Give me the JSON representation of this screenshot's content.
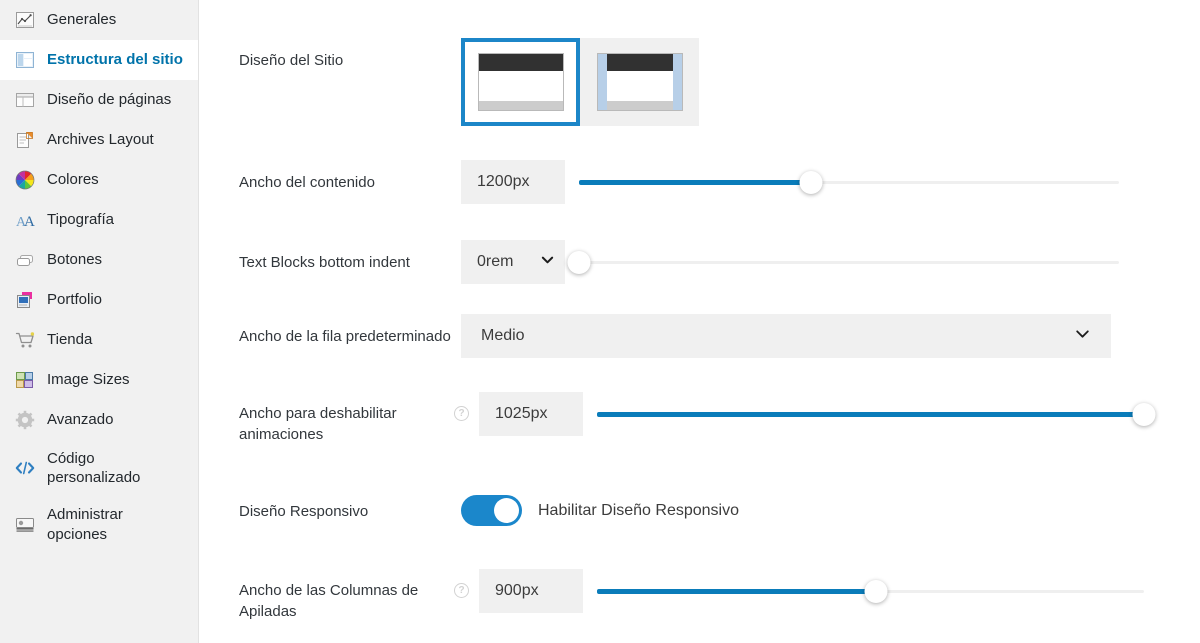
{
  "sidebar": {
    "items": [
      {
        "label": "Generales",
        "icon": "chart-icon",
        "active": false
      },
      {
        "label": "Estructura del sitio",
        "icon": "layout-panel-icon",
        "active": true
      },
      {
        "label": "Diseño de páginas",
        "icon": "page-layout-icon",
        "active": false
      },
      {
        "label": "Archives Layout",
        "icon": "archive-icon",
        "active": false
      },
      {
        "label": "Colores",
        "icon": "color-wheel-icon",
        "active": false
      },
      {
        "label": "Tipografía",
        "icon": "typography-icon",
        "active": false
      },
      {
        "label": "Botones",
        "icon": "buttons-icon",
        "active": false
      },
      {
        "label": "Portfolio",
        "icon": "portfolio-icon",
        "active": false
      },
      {
        "label": "Tienda",
        "icon": "cart-icon",
        "active": false
      },
      {
        "label": "Image Sizes",
        "icon": "image-sizes-icon",
        "active": false
      },
      {
        "label": "Avanzado",
        "icon": "gear-icon",
        "active": false
      },
      {
        "label": "Código\npersonalizado",
        "icon": "code-icon",
        "active": false
      },
      {
        "label": "Administrar\nopciones",
        "icon": "manage-options-icon",
        "active": false
      }
    ]
  },
  "settings": {
    "site_layout": {
      "label": "Diseño del Sitio",
      "options": [
        {
          "name": "full-width-layout",
          "selected": true
        },
        {
          "name": "boxed-layout",
          "selected": false
        }
      ]
    },
    "content_width": {
      "label": "Ancho del contenido",
      "value": "1200px",
      "slider_percent": 43
    },
    "text_blocks_indent": {
      "label": "Text Blocks bottom indent",
      "value": "0rem",
      "has_dropdown": true,
      "slider_percent": 0
    },
    "default_row_width": {
      "label": "Ancho de la fila predeterminado",
      "value": "Medio"
    },
    "disable_animations_width": {
      "label": "Ancho para deshabilitar animaciones",
      "value": "1025px",
      "help": "?",
      "slider_percent": 100
    },
    "responsive_design": {
      "label": "Diseño Responsivo",
      "toggle_label": "Habilitar Diseño Responsivo",
      "enabled": true
    },
    "stacked_columns_width": {
      "label": "Ancho de las Columnas de Apiladas",
      "value": "900px",
      "help": "?",
      "slider_percent": 51
    }
  },
  "colors": {
    "accent": "#0073aa",
    "slider_fill": "#0a7cba",
    "toggle_on": "#1b87cb",
    "selection_outline": "#1c86c8",
    "field_bg": "#f0f0f0",
    "sidebar_bg": "#f1f1f1"
  }
}
